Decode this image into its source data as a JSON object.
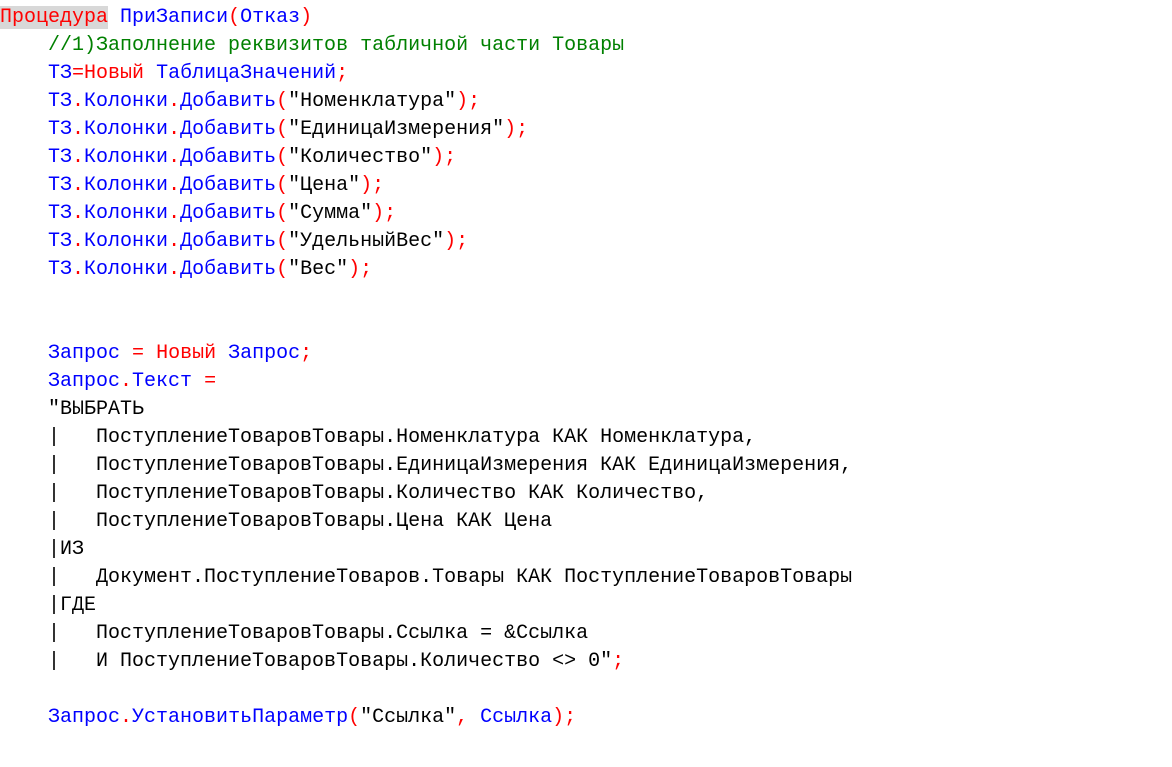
{
  "code": {
    "lines": [
      {
        "indent": 0,
        "tokens": [
          {
            "t": "Процедура",
            "c": "c-red",
            "sel": true
          },
          {
            "t": " ",
            "c": "c-black"
          },
          {
            "t": "ПриЗаписи",
            "c": "c-blue"
          },
          {
            "t": "(",
            "c": "c-red"
          },
          {
            "t": "Отказ",
            "c": "c-blue"
          },
          {
            "t": ")",
            "c": "c-red"
          }
        ]
      },
      {
        "indent": 1,
        "tokens": [
          {
            "t": "//1)Заполнение реквизитов табличной части Товары",
            "c": "c-green"
          }
        ]
      },
      {
        "indent": 1,
        "tokens": [
          {
            "t": "ТЗ",
            "c": "c-blue"
          },
          {
            "t": "=",
            "c": "c-red"
          },
          {
            "t": "Новый",
            "c": "c-red"
          },
          {
            "t": " ",
            "c": "c-black"
          },
          {
            "t": "ТаблицаЗначений",
            "c": "c-blue"
          },
          {
            "t": ";",
            "c": "c-red"
          }
        ]
      },
      {
        "indent": 1,
        "tokens": [
          {
            "t": "ТЗ",
            "c": "c-blue"
          },
          {
            "t": ".",
            "c": "c-red"
          },
          {
            "t": "Колонки",
            "c": "c-blue"
          },
          {
            "t": ".",
            "c": "c-red"
          },
          {
            "t": "Добавить",
            "c": "c-blue"
          },
          {
            "t": "(",
            "c": "c-red"
          },
          {
            "t": "\"Номенклатура\"",
            "c": "c-black"
          },
          {
            "t": ");",
            "c": "c-red"
          }
        ]
      },
      {
        "indent": 1,
        "tokens": [
          {
            "t": "ТЗ",
            "c": "c-blue"
          },
          {
            "t": ".",
            "c": "c-red"
          },
          {
            "t": "Колонки",
            "c": "c-blue"
          },
          {
            "t": ".",
            "c": "c-red"
          },
          {
            "t": "Добавить",
            "c": "c-blue"
          },
          {
            "t": "(",
            "c": "c-red"
          },
          {
            "t": "\"ЕдиницаИзмерения\"",
            "c": "c-black"
          },
          {
            "t": ");",
            "c": "c-red"
          }
        ]
      },
      {
        "indent": 1,
        "tokens": [
          {
            "t": "ТЗ",
            "c": "c-blue"
          },
          {
            "t": ".",
            "c": "c-red"
          },
          {
            "t": "Колонки",
            "c": "c-blue"
          },
          {
            "t": ".",
            "c": "c-red"
          },
          {
            "t": "Добавить",
            "c": "c-blue"
          },
          {
            "t": "(",
            "c": "c-red"
          },
          {
            "t": "\"Количество\"",
            "c": "c-black"
          },
          {
            "t": ");",
            "c": "c-red"
          }
        ]
      },
      {
        "indent": 1,
        "tokens": [
          {
            "t": "ТЗ",
            "c": "c-blue"
          },
          {
            "t": ".",
            "c": "c-red"
          },
          {
            "t": "Колонки",
            "c": "c-blue"
          },
          {
            "t": ".",
            "c": "c-red"
          },
          {
            "t": "Добавить",
            "c": "c-blue"
          },
          {
            "t": "(",
            "c": "c-red"
          },
          {
            "t": "\"Цена\"",
            "c": "c-black"
          },
          {
            "t": ");",
            "c": "c-red"
          }
        ]
      },
      {
        "indent": 1,
        "tokens": [
          {
            "t": "ТЗ",
            "c": "c-blue"
          },
          {
            "t": ".",
            "c": "c-red"
          },
          {
            "t": "Колонки",
            "c": "c-blue"
          },
          {
            "t": ".",
            "c": "c-red"
          },
          {
            "t": "Добавить",
            "c": "c-blue"
          },
          {
            "t": "(",
            "c": "c-red"
          },
          {
            "t": "\"Сумма\"",
            "c": "c-black"
          },
          {
            "t": ");",
            "c": "c-red"
          }
        ]
      },
      {
        "indent": 1,
        "tokens": [
          {
            "t": "ТЗ",
            "c": "c-blue"
          },
          {
            "t": ".",
            "c": "c-red"
          },
          {
            "t": "Колонки",
            "c": "c-blue"
          },
          {
            "t": ".",
            "c": "c-red"
          },
          {
            "t": "Добавить",
            "c": "c-blue"
          },
          {
            "t": "(",
            "c": "c-red"
          },
          {
            "t": "\"УдельныйВес\"",
            "c": "c-black"
          },
          {
            "t": ");",
            "c": "c-red"
          }
        ]
      },
      {
        "indent": 1,
        "tokens": [
          {
            "t": "ТЗ",
            "c": "c-blue"
          },
          {
            "t": ".",
            "c": "c-red"
          },
          {
            "t": "Колонки",
            "c": "c-blue"
          },
          {
            "t": ".",
            "c": "c-red"
          },
          {
            "t": "Добавить",
            "c": "c-blue"
          },
          {
            "t": "(",
            "c": "c-red"
          },
          {
            "t": "\"Вес\"",
            "c": "c-black"
          },
          {
            "t": ");",
            "c": "c-red"
          }
        ]
      },
      {
        "indent": 1,
        "tokens": []
      },
      {
        "indent": 1,
        "tokens": []
      },
      {
        "indent": 1,
        "tokens": [
          {
            "t": "Запрос",
            "c": "c-blue"
          },
          {
            "t": " ",
            "c": "c-black"
          },
          {
            "t": "=",
            "c": "c-red"
          },
          {
            "t": " ",
            "c": "c-black"
          },
          {
            "t": "Новый",
            "c": "c-red"
          },
          {
            "t": " ",
            "c": "c-black"
          },
          {
            "t": "Запрос",
            "c": "c-blue"
          },
          {
            "t": ";",
            "c": "c-red"
          }
        ]
      },
      {
        "indent": 1,
        "tokens": [
          {
            "t": "Запрос",
            "c": "c-blue"
          },
          {
            "t": ".",
            "c": "c-red"
          },
          {
            "t": "Текст",
            "c": "c-blue"
          },
          {
            "t": " ",
            "c": "c-black"
          },
          {
            "t": "=",
            "c": "c-red"
          }
        ]
      },
      {
        "indent": 1,
        "tokens": [
          {
            "t": "\"ВЫБРАТЬ",
            "c": "c-black"
          }
        ]
      },
      {
        "indent": 1,
        "tokens": [
          {
            "t": "|   ПоступлениеТоваровТовары.Номенклатура КАК Номенклатура,",
            "c": "c-black"
          }
        ]
      },
      {
        "indent": 1,
        "tokens": [
          {
            "t": "|   ПоступлениеТоваровТовары.ЕдиницаИзмерения КАК ЕдиницаИзмерения,",
            "c": "c-black"
          }
        ]
      },
      {
        "indent": 1,
        "tokens": [
          {
            "t": "|   ПоступлениеТоваровТовары.Количество КАК Количество,",
            "c": "c-black"
          }
        ]
      },
      {
        "indent": 1,
        "tokens": [
          {
            "t": "|   ПоступлениеТоваровТовары.Цена КАК Цена",
            "c": "c-black"
          }
        ]
      },
      {
        "indent": 1,
        "tokens": [
          {
            "t": "|ИЗ",
            "c": "c-black"
          }
        ]
      },
      {
        "indent": 1,
        "tokens": [
          {
            "t": "|   Документ.ПоступлениеТоваров.Товары КАК ПоступлениеТоваровТовары",
            "c": "c-black"
          }
        ]
      },
      {
        "indent": 1,
        "tokens": [
          {
            "t": "|ГДЕ",
            "c": "c-black"
          }
        ]
      },
      {
        "indent": 1,
        "tokens": [
          {
            "t": "|   ПоступлениеТоваровТовары.Ссылка = &Ссылка",
            "c": "c-black"
          }
        ]
      },
      {
        "indent": 1,
        "tokens": [
          {
            "t": "|   И ПоступлениеТоваровТовары.Количество <> 0\"",
            "c": "c-black"
          },
          {
            "t": ";",
            "c": "c-red"
          }
        ]
      },
      {
        "indent": 1,
        "tokens": []
      },
      {
        "indent": 1,
        "tokens": [
          {
            "t": "Запрос",
            "c": "c-blue"
          },
          {
            "t": ".",
            "c": "c-red"
          },
          {
            "t": "УстановитьПараметр",
            "c": "c-blue"
          },
          {
            "t": "(",
            "c": "c-red"
          },
          {
            "t": "\"Ссылка\"",
            "c": "c-black"
          },
          {
            "t": ",",
            "c": "c-red"
          },
          {
            "t": " ",
            "c": "c-black"
          },
          {
            "t": "Ссылка",
            "c": "c-blue"
          },
          {
            "t": ");",
            "c": "c-red"
          }
        ]
      }
    ],
    "indent_unit": "    "
  }
}
